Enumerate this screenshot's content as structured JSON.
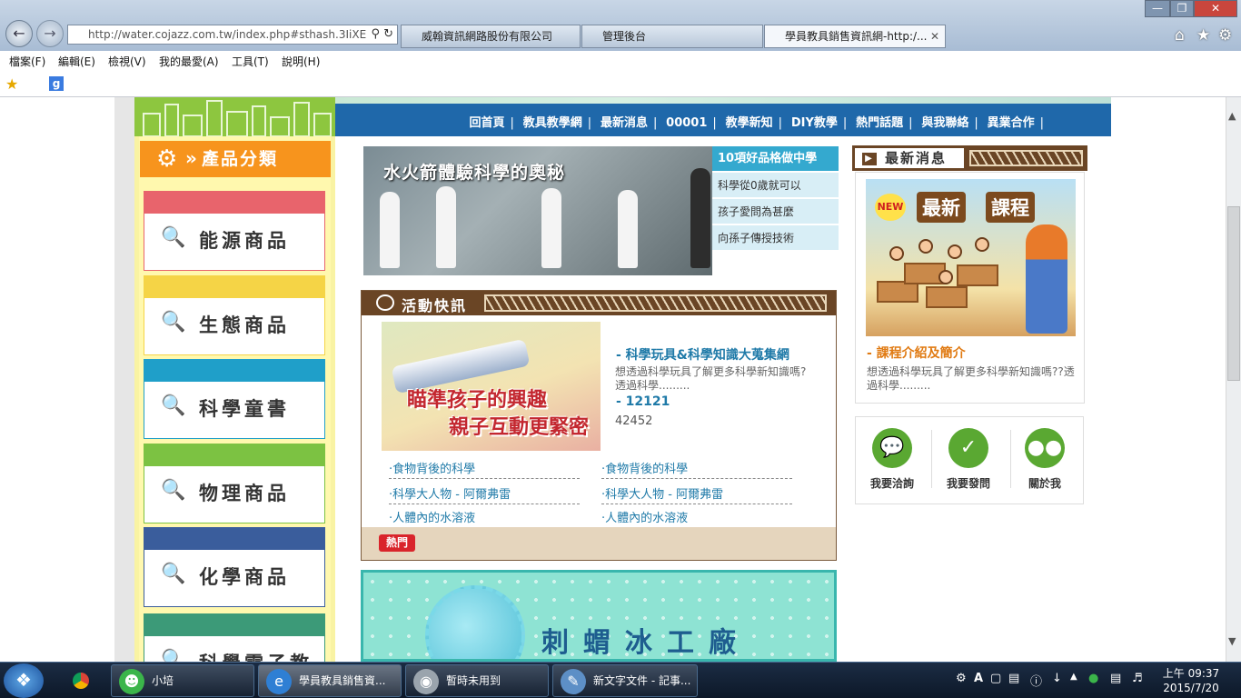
{
  "browser": {
    "url": "http://water.cojazz.com.tw/index.php#sthash.3IiXE",
    "tabs": [
      {
        "label": "威翰資訊網路股份有限公司"
      },
      {
        "label": "管理後台"
      },
      {
        "label": "學員教具銷售資訊網-http:/..."
      }
    ],
    "menu": [
      "檔案(F)",
      "編輯(E)",
      "檢視(V)",
      "我的最愛(A)",
      "工具(T)",
      "說明(H)"
    ]
  },
  "site": {
    "nav": [
      "回首頁",
      "教具教學網",
      "最新消息",
      "00001",
      "教學新知",
      "DIY教學",
      "熱門話題",
      "與我聯絡",
      "異業合作"
    ],
    "categories_title": "產品分類",
    "categories": [
      {
        "label": "能源商品",
        "color": "#e8646c"
      },
      {
        "label": "生態商品",
        "color": "#f5d446"
      },
      {
        "label": "科學童書",
        "color": "#1f9fc9"
      },
      {
        "label": "物理商品",
        "color": "#7cc242"
      },
      {
        "label": "化學商品",
        "color": "#3a5d9c"
      },
      {
        "label": "科學電子教學",
        "color": "#3c9a78"
      }
    ],
    "slider": {
      "caption": "水火箭體驗科學的奧秘",
      "items": [
        "10項好品格做中學",
        "科學從0歲就可以",
        "孩子愛問為甚麼",
        "向孫子傳授技術"
      ]
    },
    "activity": {
      "title": "活動快訊",
      "image_lines": [
        "瞄準孩子的興趣",
        "親子互動更緊密"
      ],
      "item1_title": "- 科學玩具&科學知識大蒐集網",
      "item1_desc": "想透過科學玩具了解更多科學新知識嗎?透過科學.........",
      "item2_title": "- 12121",
      "item2_desc": "42452",
      "links": [
        "·食物背後的科學",
        "·食物背後的科學",
        "·科學大人物 - 阿爾弗雷",
        "·科學大人物 - 阿爾弗雷",
        "·人體內的水溶液",
        "·人體內的水溶液"
      ],
      "hot": "熱門"
    },
    "ice_banner": "刺蝟冰工廠",
    "news": {
      "title": "最新消息",
      "image_text": [
        "NEW",
        "最新",
        "課程"
      ],
      "item_title": "- 課程介紹及簡介",
      "item_desc": "想透過科學玩具了解更多科學新知識嗎??透過科學........."
    },
    "quick": [
      "我要洽詢",
      "我要發問",
      "關於我"
    ]
  },
  "taskbar": {
    "buttons": [
      {
        "label": "小培",
        "color": "#3bb54a"
      },
      {
        "label": "學員教具銷售資...",
        "color": "#2f7fd4"
      },
      {
        "label": "暫時未用到",
        "color": "#9aa4ad"
      },
      {
        "label": "新文字文件 - 記事...",
        "color": "#5d8fc6"
      }
    ],
    "time": "上午 09:37",
    "date": "2015/7/20"
  }
}
